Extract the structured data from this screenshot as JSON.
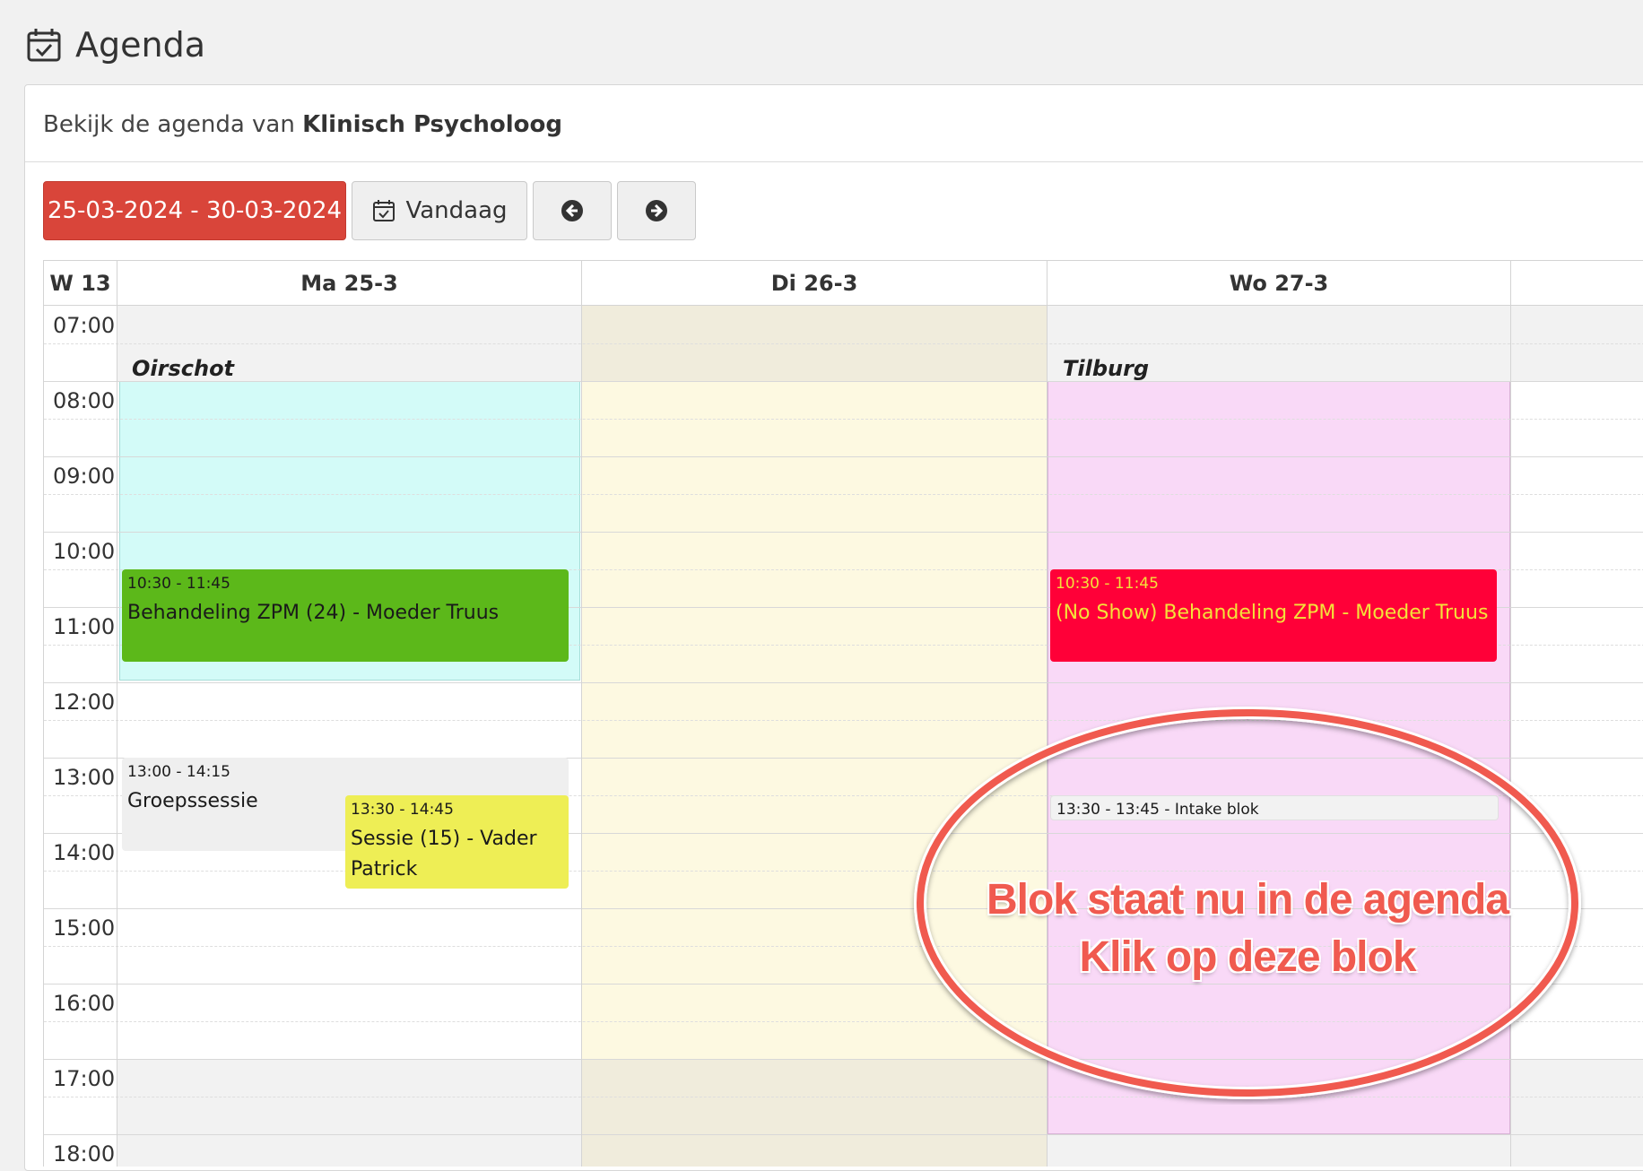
{
  "header": {
    "title": "Agenda",
    "icon": "calendar-check-icon"
  },
  "subtitle": {
    "prefix": "Bekijk de agenda van",
    "name": "Klinisch Psycholoog"
  },
  "toolbar": {
    "date_range": "25-03-2024 - 30-03-2024",
    "today_label": "Vandaag",
    "prev_icon": "arrow-left-circle-icon",
    "next_icon": "arrow-right-circle-icon"
  },
  "calendar": {
    "week_label": "W 13",
    "days": [
      "Ma 25-3",
      "Di 26-3",
      "Wo 27-3"
    ],
    "times": [
      "07:00",
      "08:00",
      "09:00",
      "10:00",
      "11:00",
      "12:00",
      "13:00",
      "14:00",
      "15:00",
      "16:00",
      "17:00",
      "18:00"
    ],
    "locations": {
      "monday": "Oirschot",
      "wednesday": "Tilburg"
    },
    "colors": {
      "monday_block": "#d3fbf8",
      "tuesday_block": "#fdf9e1",
      "wednesday_block": "#f9d9f7",
      "accent": "#d9453a"
    },
    "events": {
      "e1": {
        "time": "10:30 - 11:45",
        "title": "Behandeling ZPM (24) - Moeder Truus",
        "color": "#5cb81a"
      },
      "e2": {
        "time": "10:30 - 11:45",
        "title": "(No Show) Behandeling ZPM - Moeder Truus",
        "color": "#ff0038"
      },
      "e3": {
        "time": "13:00 - 14:15",
        "title": "Groepssessie",
        "color": "#efefef"
      },
      "e4": {
        "time": "13:30 - 14:45",
        "title": "Sessie (15) - Vader Patrick",
        "color": "#eeee55"
      },
      "e5": {
        "label": "13:30 - 13:45 - Intake blok",
        "color": "#f2f2f2"
      }
    }
  },
  "annotation": {
    "line1": "Blok staat nu in de agenda",
    "line2": "Klik op deze blok"
  }
}
